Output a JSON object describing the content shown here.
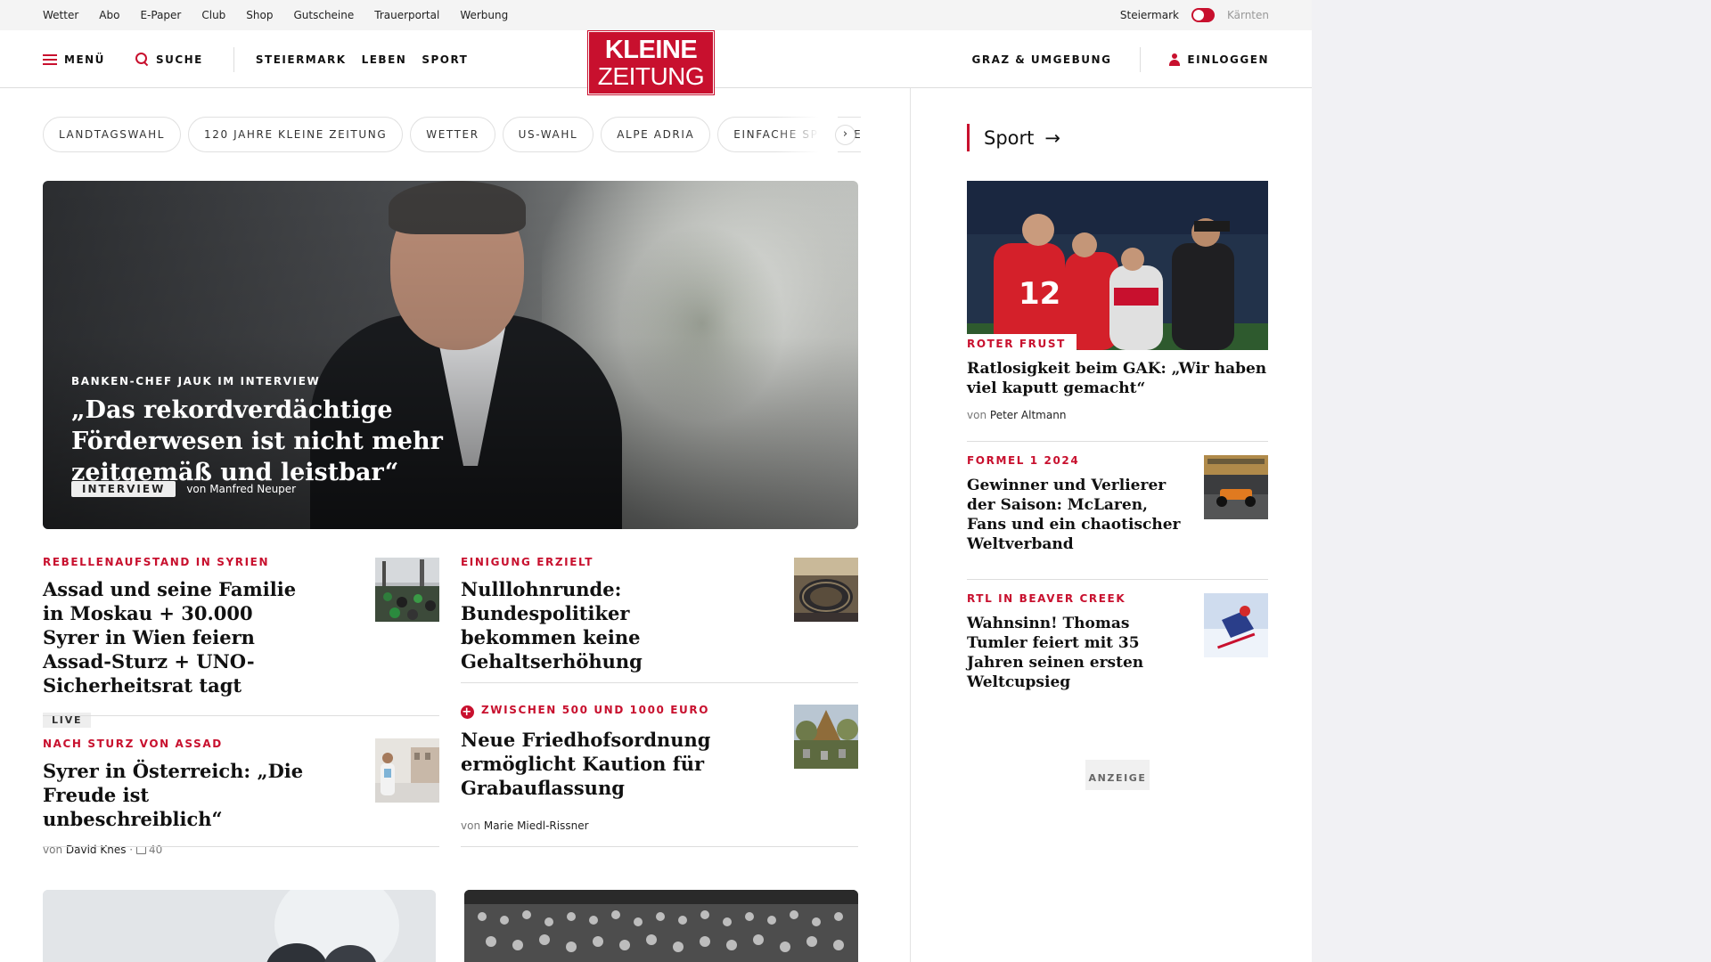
{
  "utility": {
    "links": [
      "Wetter",
      "Abo",
      "E-Paper",
      "Club",
      "Shop",
      "Gutscheine",
      "Trauerportal",
      "Werbung"
    ],
    "region_active": "Steiermark",
    "region_inactive": "Kärnten"
  },
  "header": {
    "menu_label": "MENÜ",
    "search_label": "SUCHE",
    "nav": [
      "STEIERMARK",
      "LEBEN",
      "SPORT"
    ],
    "logo_line1": "KLEINE",
    "logo_line2": "ZEITUNG",
    "local_label": "GRAZ & UMGEBUNG",
    "login_label": "EINLOGGEN"
  },
  "chips": [
    "LANDTAGSWAHL",
    "120 JAHRE KLEINE ZEITUNG",
    "WETTER",
    "US-WAHL",
    "ALPE ADRIA",
    "EINFACHE SPRACHE"
  ],
  "chip_next": "›",
  "hero": {
    "kicker": "BANKEN-CHEF JAUK IM INTERVIEW",
    "headline": "„Das rekordverdächtige Förderwesen ist nicht mehr zeitgemäß und leistbar“",
    "tag": "INTERVIEW",
    "byline": "von Manfred Neuper"
  },
  "articles": {
    "a1": {
      "kicker": "REBELLENAUFSTAND IN SYRIEN",
      "headline": "Assad und seine Familie in Moskau + 30.000 Syrer in Wien feiern Assad-Sturz + UNO-Sicherheitsrat tagt",
      "badge": "LIVE"
    },
    "a2": {
      "kicker": "EINIGUNG ERZIELT",
      "headline": "Nulllohnrunde: Bundespolitiker bekommen keine Gehaltserhöhung"
    },
    "a3": {
      "kicker": "NACH STURZ VON ASSAD",
      "headline": "Syrer in Österreich: „Die Freude ist unbeschreiblich“",
      "von": "von",
      "author": "David Knes",
      "sep": "·",
      "comments": "40"
    },
    "a4": {
      "kicker": "ZWISCHEN 500 UND 1000 EURO",
      "headline": "Neue Friedhofsordnung ermöglicht Kaution für Grabauflassung",
      "von": "von",
      "author": "Marie Miedl-Rissner"
    }
  },
  "sidebar": {
    "section_title": "Sport",
    "section_arrow": "→",
    "s1": {
      "kicker": "ROTER FRUST",
      "headline": "Ratlosigkeit beim GAK: „Wir haben viel kaputt gemacht“",
      "von": "von",
      "author": "Peter Altmann"
    },
    "s2": {
      "kicker": "FORMEL 1 2024",
      "headline": "Gewinner und Verlierer der Saison: McLaren, Fans und ein chaotischer Weltverband"
    },
    "s3": {
      "kicker": "RTL IN BEAVER CREEK",
      "headline": "Wahnsinn! Thomas Tumler feiert mit 35 Jahren seinen ersten Weltcupsieg"
    },
    "ad_label": "ANZEIGE"
  },
  "colors": {
    "brand_red": "#c8102e",
    "text": "#111111",
    "page_bg": "#f1f1f4"
  }
}
